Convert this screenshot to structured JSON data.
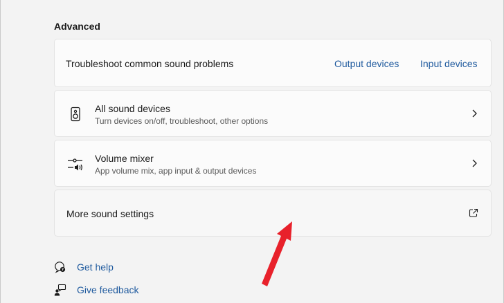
{
  "section": {
    "title": "Advanced"
  },
  "troubleshoot": {
    "label": "Troubleshoot common sound problems",
    "output_link": "Output devices",
    "input_link": "Input devices"
  },
  "all_devices": {
    "title": "All sound devices",
    "subtitle": "Turn devices on/off, troubleshoot, other options",
    "icon": "speaker-icon"
  },
  "volume_mixer": {
    "title": "Volume mixer",
    "subtitle": "App volume mix, app input & output devices",
    "icon": "mixer-icon"
  },
  "more_settings": {
    "label": "More sound settings",
    "icon": "external-link-icon"
  },
  "footer": {
    "help": "Get help",
    "feedback": "Give feedback"
  },
  "colors": {
    "accent_link": "#1f5a9e",
    "annotation_arrow": "#e8212b",
    "background": "#f3f3f3",
    "card": "#fbfbfb"
  }
}
